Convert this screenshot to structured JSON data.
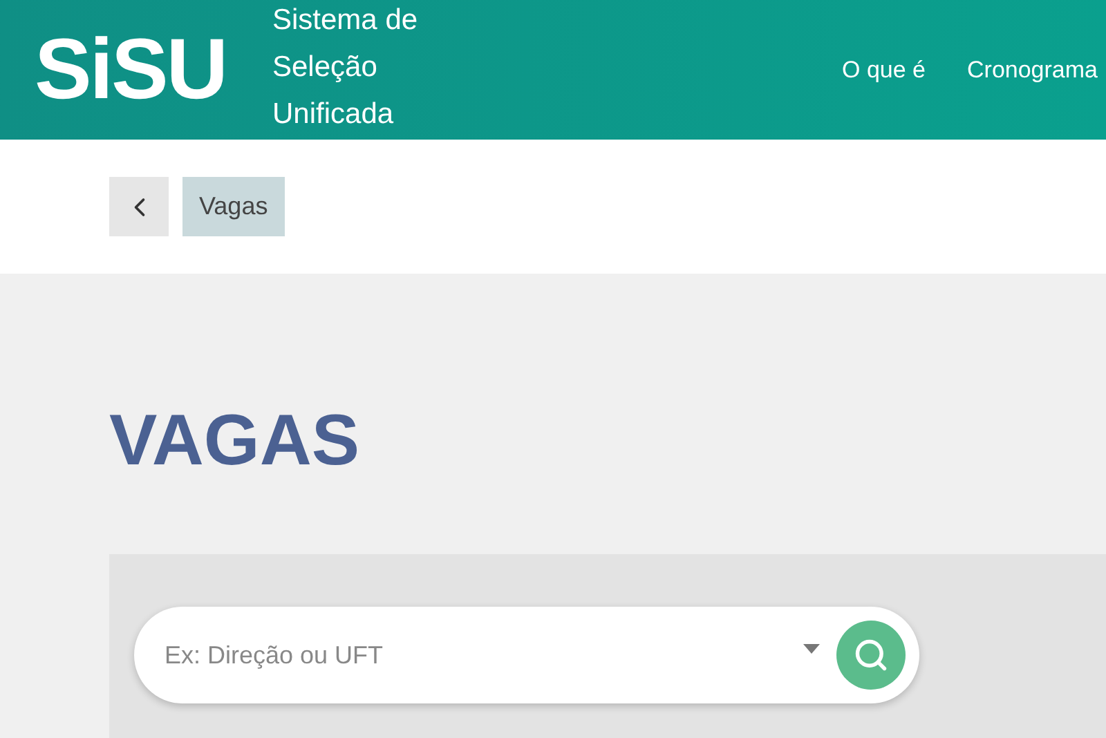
{
  "header": {
    "logo": "SiSU",
    "subtitle_lines": [
      "Sistema de",
      "Seleção",
      "Unificada"
    ],
    "nav": [
      "O que é",
      "Cronograma"
    ]
  },
  "breadcrumb": {
    "items": [
      "Vagas"
    ]
  },
  "page": {
    "title": "VAGAS"
  },
  "search": {
    "placeholder": "Ex: Direção ou UFT"
  }
}
